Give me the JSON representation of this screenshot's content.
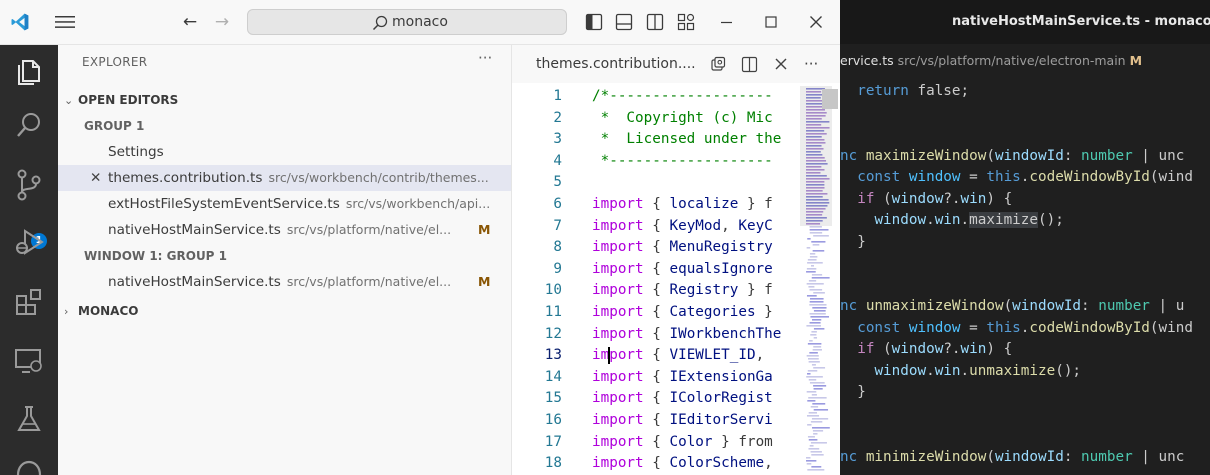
{
  "background_window": {
    "title": "nativeHostMainService.ts - monaco -",
    "breadcrumb": {
      "file_partial": "ervice.ts",
      "path": "src/vs/platform/native/electron-main",
      "status": "M"
    },
    "code_lines": [
      {
        "segments": [
          [
            "  ",
            "p"
          ],
          [
            "return",
            "kw2"
          ],
          [
            " false;",
            "p"
          ]
        ]
      },
      {
        "segments": []
      },
      {
        "segments": []
      },
      {
        "segments": [
          [
            "nc ",
            "kw2"
          ],
          [
            "maximizeWindow",
            "fn2"
          ],
          [
            "(",
            "p"
          ],
          [
            "windowId",
            "var"
          ],
          [
            ": ",
            "p"
          ],
          [
            "number",
            "ty"
          ],
          [
            " | unc",
            "p"
          ]
        ]
      },
      {
        "segments": [
          [
            "  ",
            "p"
          ],
          [
            "const",
            "kw2"
          ],
          [
            " ",
            "p"
          ],
          [
            "window",
            "cn"
          ],
          [
            " = ",
            "p"
          ],
          [
            "this",
            "kw2"
          ],
          [
            ".",
            "p"
          ],
          [
            "codeWindowById",
            "fn2"
          ],
          [
            "(wind",
            "p"
          ]
        ]
      },
      {
        "segments": [
          [
            "  ",
            "p"
          ],
          [
            "if",
            "kwc"
          ],
          [
            " (",
            "p"
          ],
          [
            "window",
            "var"
          ],
          [
            "?.",
            "p"
          ],
          [
            "win",
            "var"
          ],
          [
            ") {",
            "p"
          ]
        ]
      },
      {
        "segments": [
          [
            "    ",
            "p"
          ],
          [
            "window",
            "var"
          ],
          [
            ".",
            "p"
          ],
          [
            "win",
            "var"
          ],
          [
            ".",
            "p"
          ],
          [
            "maximize",
            "hl"
          ],
          [
            "();",
            "p"
          ]
        ]
      },
      {
        "segments": [
          [
            "  }",
            "p"
          ]
        ]
      },
      {
        "segments": []
      },
      {
        "segments": []
      },
      {
        "segments": [
          [
            "nc ",
            "kw2"
          ],
          [
            "unmaximizeWindow",
            "fn2"
          ],
          [
            "(",
            "p"
          ],
          [
            "windowId",
            "var"
          ],
          [
            ": ",
            "p"
          ],
          [
            "number",
            "ty"
          ],
          [
            " | u",
            "p"
          ]
        ]
      },
      {
        "segments": [
          [
            "  ",
            "p"
          ],
          [
            "const",
            "kw2"
          ],
          [
            " ",
            "p"
          ],
          [
            "window",
            "cn"
          ],
          [
            " = ",
            "p"
          ],
          [
            "this",
            "kw2"
          ],
          [
            ".",
            "p"
          ],
          [
            "codeWindowById",
            "fn2"
          ],
          [
            "(wind",
            "p"
          ]
        ]
      },
      {
        "segments": [
          [
            "  ",
            "p"
          ],
          [
            "if",
            "kwc"
          ],
          [
            " (",
            "p"
          ],
          [
            "window",
            "var"
          ],
          [
            "?.",
            "p"
          ],
          [
            "win",
            "var"
          ],
          [
            ") {",
            "p"
          ]
        ]
      },
      {
        "segments": [
          [
            "    ",
            "p"
          ],
          [
            "window",
            "var"
          ],
          [
            ".",
            "p"
          ],
          [
            "win",
            "var"
          ],
          [
            ".",
            "p"
          ],
          [
            "unmaximize",
            "fn2"
          ],
          [
            "();",
            "p"
          ]
        ]
      },
      {
        "segments": [
          [
            "  }",
            "p"
          ]
        ]
      },
      {
        "segments": []
      },
      {
        "segments": []
      },
      {
        "segments": [
          [
            "nc ",
            "kw2"
          ],
          [
            "minimizeWindow",
            "fn2"
          ],
          [
            "(",
            "p"
          ],
          [
            "windowId",
            "var"
          ],
          [
            ": ",
            "p"
          ],
          [
            "number",
            "ty"
          ],
          [
            " | unc",
            "p"
          ]
        ]
      }
    ]
  },
  "titlebar": {
    "search_text": "monaco",
    "icons": [
      "vscode-logo-icon",
      "menu-icon",
      "back-arrow-icon",
      "forward-arrow-icon",
      "search-icon",
      "toggle-sidebar-icon",
      "toggle-panel-icon",
      "toggle-secondary-sidebar-icon",
      "customize-layout-icon",
      "minimize-icon",
      "maximize-icon",
      "close-icon"
    ]
  },
  "activity_bar": {
    "items": [
      "explorer-icon",
      "search-icon",
      "source-control-icon",
      "run-debug-icon",
      "extensions-icon",
      "remote-explorer-icon",
      "testing-icon",
      "github-icon"
    ],
    "source_control_badge": "1"
  },
  "sidebar": {
    "title": "EXPLORER",
    "more": "···",
    "sections": {
      "open_editors": "OPEN EDITORS",
      "group1": "GROUP 1",
      "window1_group1": "WINDOW 1: GROUP 1",
      "monaco": "MONACO"
    },
    "editors": [
      {
        "name": "Settings",
        "desc": "",
        "status": ""
      },
      {
        "name": "themes.contribution.ts",
        "desc": "src/vs/workbench/contrib/themes...",
        "status": ""
      },
      {
        "name": "extHostFileSystemEventService.ts",
        "desc": "src/vs/workbench/api...",
        "status": ""
      },
      {
        "name": "nativeHostMainService.ts",
        "desc": "src/vs/platform/native/el...",
        "status": "M"
      }
    ],
    "window1_editors": [
      {
        "name": "nativeHostMainService.ts",
        "desc": "src/vs/platform/native/el...",
        "status": "M"
      }
    ]
  },
  "editor": {
    "tab_label": "themes.contribution....",
    "line_numbers": [
      "1",
      "2",
      "3",
      "4",
      "5",
      "6",
      "7",
      "8",
      "9",
      "10",
      "11",
      "12",
      "13",
      "14",
      "15",
      "16",
      "17",
      "18"
    ],
    "current_line": 13,
    "lines": [
      [
        [
          "/*-------------------",
          "com"
        ]
      ],
      [
        [
          " *  Copyright (c) Mic",
          "com"
        ]
      ],
      [
        [
          " *  Licensed under the",
          "com"
        ]
      ],
      [
        [
          " *-------------------",
          "com"
        ]
      ],
      [],
      [
        [
          "import",
          "kw"
        ],
        [
          " { ",
          "p"
        ],
        [
          "localize",
          "id"
        ],
        [
          " } f",
          "p"
        ]
      ],
      [
        [
          "import",
          "kw"
        ],
        [
          " { ",
          "p"
        ],
        [
          "KeyMod",
          "id"
        ],
        [
          ", ",
          "p"
        ],
        [
          "KeyC",
          "id"
        ]
      ],
      [
        [
          "import",
          "kw"
        ],
        [
          " { ",
          "p"
        ],
        [
          "MenuRegistry",
          "id"
        ]
      ],
      [
        [
          "import",
          "kw"
        ],
        [
          " { ",
          "p"
        ],
        [
          "equalsIgnore",
          "id"
        ]
      ],
      [
        [
          "import",
          "kw"
        ],
        [
          " { ",
          "p"
        ],
        [
          "Registry",
          "id"
        ],
        [
          " } f",
          "p"
        ]
      ],
      [
        [
          "import",
          "kw"
        ],
        [
          " { ",
          "p"
        ],
        [
          "Categories",
          "id"
        ],
        [
          " }",
          "p"
        ]
      ],
      [
        [
          "import",
          "kw"
        ],
        [
          " { ",
          "p"
        ],
        [
          "IWorkbenchThe",
          "id"
        ]
      ],
      [
        [
          "im",
          "kw"
        ],
        [
          "|",
          "cur"
        ],
        [
          "port",
          "kw"
        ],
        [
          " { ",
          "p"
        ],
        [
          "VIEWLET_ID",
          "id"
        ],
        [
          ",",
          "p"
        ]
      ],
      [
        [
          "import",
          "kw"
        ],
        [
          " { ",
          "p"
        ],
        [
          "IExtensionGa",
          "id"
        ]
      ],
      [
        [
          "import",
          "kw"
        ],
        [
          " { ",
          "p"
        ],
        [
          "IColorRegist",
          "id"
        ]
      ],
      [
        [
          "import",
          "kw"
        ],
        [
          " { ",
          "p"
        ],
        [
          "IEditorServi",
          "id"
        ]
      ],
      [
        [
          "import",
          "kw"
        ],
        [
          " { ",
          "p"
        ],
        [
          "Color",
          "id"
        ],
        [
          " } from",
          "p"
        ]
      ],
      [
        [
          "import",
          "kw"
        ],
        [
          " { ",
          "p"
        ],
        [
          "ColorScheme",
          "id"
        ],
        [
          ",",
          "p"
        ]
      ]
    ]
  }
}
